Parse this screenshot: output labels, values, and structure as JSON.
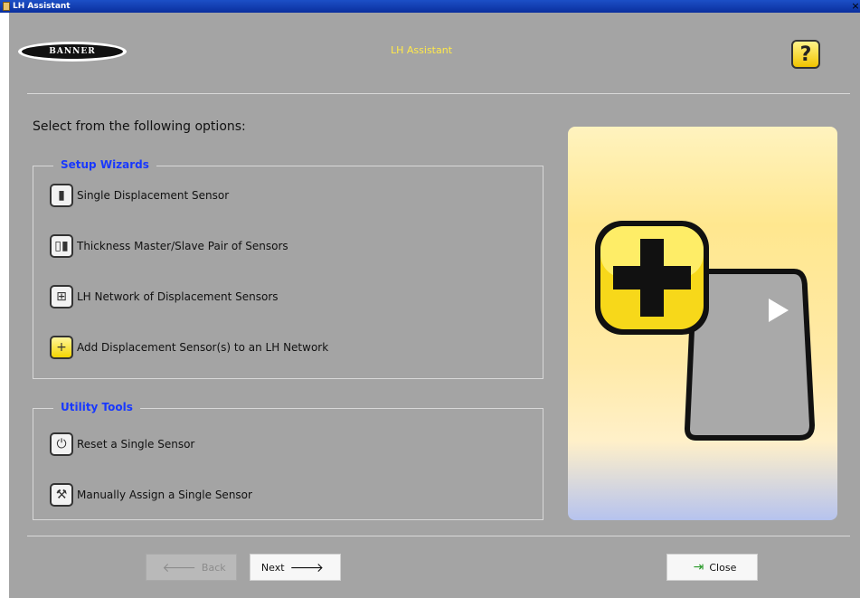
{
  "window": {
    "title": "LH Assistant",
    "close_glyph": "×"
  },
  "header": {
    "brand": "BANNER",
    "app_title": "LH Assistant",
    "help_label": "?"
  },
  "prompt": "Select from the following options:",
  "setup_wizards": {
    "title": "Setup Wizards",
    "items": [
      {
        "label": "Single Displacement Sensor",
        "icon": "single-sensor-icon"
      },
      {
        "label": "Thickness Master/Slave Pair of Sensors",
        "icon": "sensor-pair-icon"
      },
      {
        "label": "LH Network of Displacement Sensors",
        "icon": "network-icon"
      },
      {
        "label": "Add Displacement Sensor(s) to an LH Network",
        "icon": "add-sensor-icon"
      }
    ]
  },
  "utility_tools": {
    "title": "Utility Tools",
    "items": [
      {
        "label": "Reset a Single Sensor",
        "icon": "reset-icon"
      },
      {
        "label": "Manually Assign a Single Sensor",
        "icon": "wrench-icon"
      }
    ]
  },
  "footer": {
    "back_label": "Back",
    "next_label": "Next",
    "close_label": "Close"
  },
  "colors": {
    "title_blue": "#1c4fc6",
    "group_title": "#1838ff",
    "heading_yellow": "#ffe94a",
    "panel_gray": "#a4a4a4"
  }
}
